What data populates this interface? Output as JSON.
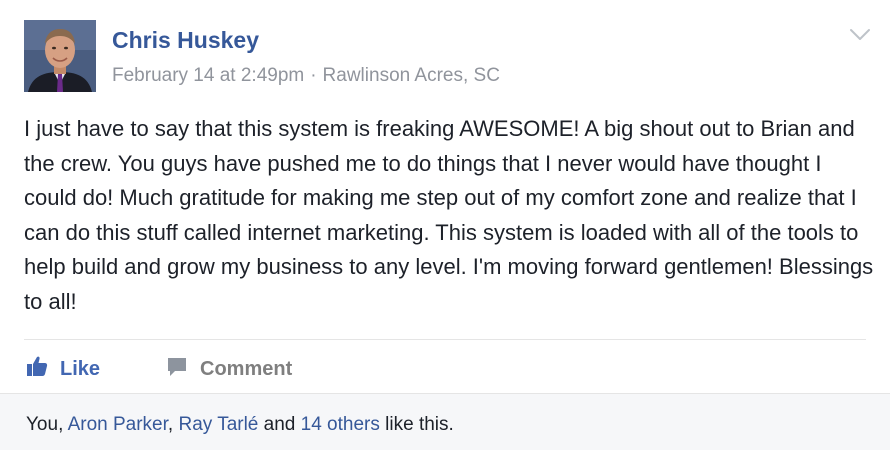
{
  "post": {
    "author": "Chris Huskey",
    "date": "February 14 at 2:49pm",
    "separator": "·",
    "location": "Rawlinson Acres, SC",
    "text": "I just have to say that this system is freaking AWESOME! A big shout out to Brian and the crew. You guys have pushed me to do things that I never would have thought I could do! Much gratitude for making me step out of my comfort zone and realize that I can do this stuff called internet marketing. This system is loaded with all of the tools to help build and grow my business to any level. I'm moving forward gentlemen! Blessings to all!"
  },
  "actions": {
    "like_label": "Like",
    "comment_label": "Comment",
    "like_icon": "thumbs-up-icon",
    "comment_icon": "speech-bubble-icon"
  },
  "likes": {
    "you": "You",
    "comma1": ", ",
    "person1": "Aron Parker",
    "comma2": ", ",
    "person2": "Ray Tarlé",
    "and": " and ",
    "others": "14 others",
    "suffix": " like this."
  },
  "colors": {
    "link": "#365899",
    "like_blue": "#4267b2",
    "meta_gray": "#90949c",
    "text": "#1d2129",
    "footer_bg": "#f6f7f9"
  }
}
